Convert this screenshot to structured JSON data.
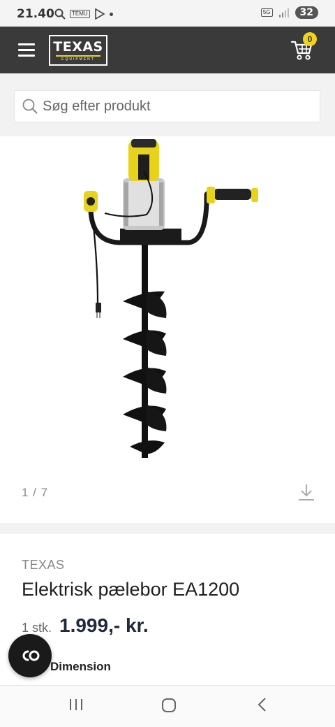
{
  "status_bar": {
    "time": "21.40",
    "notif_label": "TEMU",
    "network_label": "5G",
    "battery": "32"
  },
  "header": {
    "logo_name": "TEXAS",
    "logo_sub": "EQUIPMENT",
    "cart_count": "0"
  },
  "search": {
    "placeholder": "Søg efter produkt"
  },
  "gallery": {
    "pager": "1 / 7"
  },
  "product": {
    "brand": "TEXAS",
    "title": "Elektrisk pælebor EA1200",
    "quantity": "1 stk.",
    "price": "1.999,- kr.",
    "attribute_label": "Dimension"
  },
  "colors": {
    "header_bg": "#3a3a3a",
    "accent_yellow": "#f2d21c",
    "price_text": "#1f2a3a"
  },
  "icons": [
    "search-icon",
    "menu-icon",
    "cart-icon",
    "download-icon",
    "cookie-icon",
    "recent-apps-icon",
    "home-icon",
    "back-icon"
  ]
}
